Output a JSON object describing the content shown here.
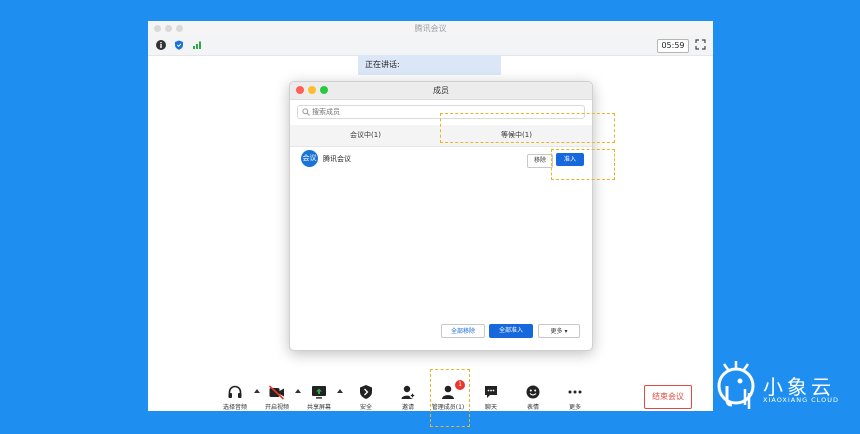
{
  "window": {
    "title": "腾讯会议",
    "timer": "05:59"
  },
  "speaking": {
    "label": "正在讲话:"
  },
  "dialog": {
    "title": "成员",
    "search_placeholder": "搜索成员",
    "tabs": [
      {
        "label": "会议中(1)"
      },
      {
        "label": "等候中(1)"
      }
    ],
    "member": {
      "avatar_text": "会议",
      "name": "腾讯会议",
      "remove_label": "移除",
      "admit_label": "准入"
    },
    "bottom": {
      "remove_all": "全部移除",
      "admit_all": "全部准入",
      "more": "更多 ▾"
    }
  },
  "toolbar": {
    "items": [
      {
        "label": "选择音频",
        "icon": "headset-icon"
      },
      {
        "label": "开启视频",
        "icon": "video-off-icon"
      },
      {
        "label": "共享屏幕",
        "icon": "share-screen-icon"
      },
      {
        "label": "安全",
        "icon": "shield-icon"
      },
      {
        "label": "邀请",
        "icon": "invite-icon"
      },
      {
        "label": "管理成员(1)",
        "icon": "members-icon"
      },
      {
        "label": "聊天",
        "icon": "chat-icon"
      },
      {
        "label": "表情",
        "icon": "emoji-icon"
      },
      {
        "label": "更多",
        "icon": "more-icon"
      }
    ],
    "badge": "1",
    "end_label": "结束会议"
  },
  "brand": {
    "name": "小象云",
    "sub": "XIAOXIANG CLOUD"
  },
  "colors": {
    "background": "#1f8ef1",
    "accent": "#1668dc",
    "end_red": "#e04a3f",
    "highlight": "#e6b52c"
  }
}
